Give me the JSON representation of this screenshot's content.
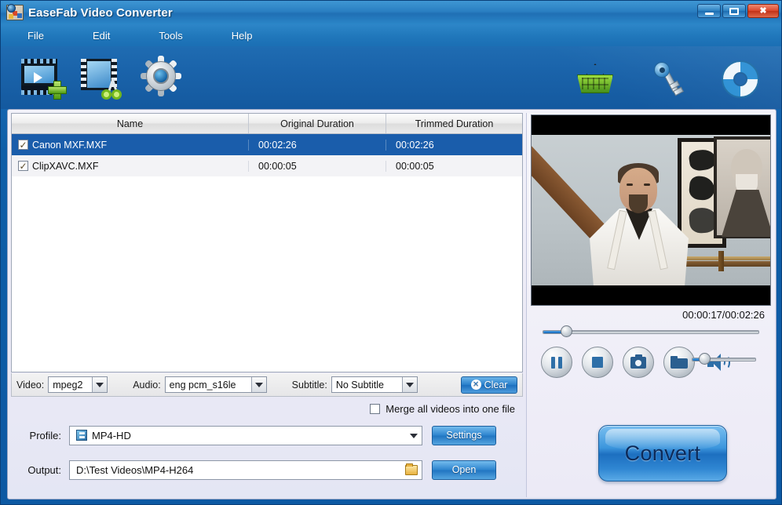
{
  "window": {
    "title": "EaseFab Video Converter",
    "app_icon": "film-app-icon",
    "minimize": "minimize-button",
    "maximize": "maximize-button",
    "close": "close-button"
  },
  "menu": {
    "items": [
      {
        "label": "File"
      },
      {
        "label": "Edit"
      },
      {
        "label": "Tools"
      },
      {
        "label": "Help"
      }
    ]
  },
  "toolbar": {
    "left": [
      {
        "name": "add-video-icon",
        "tooltip": "Add Video"
      },
      {
        "name": "trim-video-icon",
        "tooltip": "Trim"
      },
      {
        "name": "settings-gear-icon",
        "tooltip": "Settings"
      }
    ],
    "right": [
      {
        "name": "buy-basket-icon",
        "tooltip": "Buy"
      },
      {
        "name": "register-key-icon",
        "tooltip": "Register"
      },
      {
        "name": "support-lifebuoy-icon",
        "tooltip": "Support"
      }
    ]
  },
  "file_list": {
    "columns": [
      "Name",
      "Original Duration",
      "Trimmed Duration"
    ],
    "rows": [
      {
        "checked": true,
        "selected": true,
        "name": "Canon MXF.MXF",
        "original_duration": "00:02:26",
        "trimmed_duration": "00:02:26"
      },
      {
        "checked": true,
        "selected": false,
        "name": "ClipXAVC.MXF",
        "original_duration": "00:00:05",
        "trimmed_duration": "00:00:05"
      }
    ]
  },
  "codec_bar": {
    "video_label": "Video:",
    "video_value": "mpeg2",
    "audio_label": "Audio:",
    "audio_value": "eng pcm_s16le",
    "subtitle_label": "Subtitle:",
    "subtitle_value": "No Subtitle",
    "clear_label": "Clear",
    "clear_icon": "close-circle-icon"
  },
  "merge": {
    "label": "Merge all videos into one file",
    "checked": false
  },
  "profile": {
    "label": "Profile:",
    "value": "MP4-HD",
    "icon": "profile-format-icon",
    "settings_label": "Settings"
  },
  "output": {
    "label": "Output:",
    "value": "D:\\Test Videos\\MP4-H264",
    "browse_icon": "folder-icon",
    "open_label": "Open"
  },
  "preview": {
    "time_display": "00:00:17/00:02:26",
    "seek_percent": 11,
    "volume_percent": 20,
    "controls": [
      {
        "name": "pause-button"
      },
      {
        "name": "stop-button"
      },
      {
        "name": "snapshot-button"
      },
      {
        "name": "open-snapshot-folder-button"
      }
    ],
    "speaker_icon": "speaker-icon"
  },
  "convert": {
    "label": "Convert"
  },
  "colors": {
    "title_bar": "#2a7fc2",
    "toolbar": "#1a63aa",
    "panel": "#eceaf6",
    "selection": "#1a5dab",
    "accent_button": "#2a80cc",
    "close_button": "#d8452a"
  }
}
